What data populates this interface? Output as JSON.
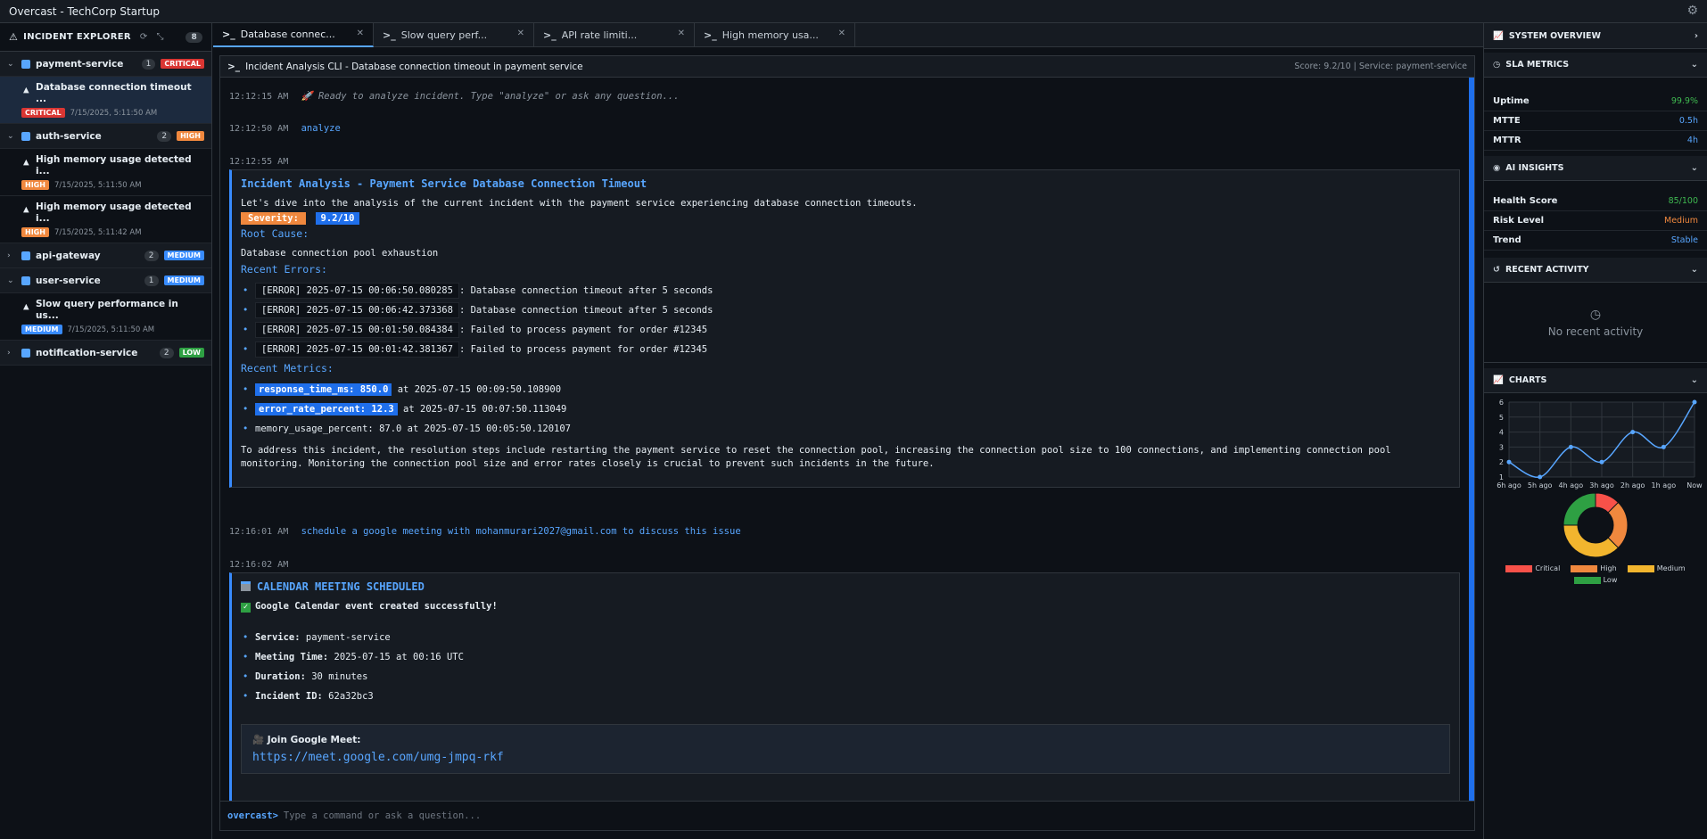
{
  "app": {
    "title": "Overcast - TechCorp Startup"
  },
  "sidebar": {
    "header": "INCIDENT EXPLORER",
    "count": "8",
    "services": [
      {
        "name": "payment-service",
        "count": "1",
        "severity": "CRITICAL",
        "incidents": [
          {
            "title": "Database connection timeout ...",
            "severity": "CRITICAL",
            "time": "7/15/2025, 5:11:50 AM"
          }
        ]
      },
      {
        "name": "auth-service",
        "count": "2",
        "severity": "HIGH",
        "incidents": [
          {
            "title": "High memory usage detected i...",
            "severity": "HIGH",
            "time": "7/15/2025, 5:11:50 AM"
          },
          {
            "title": "High memory usage detected i...",
            "severity": "HIGH",
            "time": "7/15/2025, 5:11:42 AM"
          }
        ]
      },
      {
        "name": "api-gateway",
        "count": "2",
        "severity": "MEDIUM",
        "incidents": []
      },
      {
        "name": "user-service",
        "count": "1",
        "severity": "MEDIUM",
        "incidents": [
          {
            "title": "Slow query performance in us...",
            "severity": "MEDIUM",
            "time": "7/15/2025, 5:11:50 AM"
          }
        ]
      },
      {
        "name": "notification-service",
        "count": "2",
        "severity": "LOW",
        "incidents": []
      }
    ]
  },
  "tabs": [
    {
      "label": "Database connec..."
    },
    {
      "label": "Slow query perf..."
    },
    {
      "label": "API rate limiti..."
    },
    {
      "label": "High memory usa..."
    }
  ],
  "main": {
    "header": "Incident Analysis CLI - Database connection timeout in payment service",
    "score": "Score: 9.2/10 | Service: payment-service",
    "log": {
      "l1_time": "12:12:15 AM",
      "l1_text": "🚀 Ready to analyze incident. Type \"analyze\" or ask any question...",
      "l2_time": "12:12:50 AM",
      "l2_text": "analyze",
      "l3_time": "12:12:55 AM",
      "analysis": {
        "title": "Incident Analysis - Payment Service Database Connection Timeout",
        "intro": "Let's dive into the analysis of the current incident with the payment service experiencing database connection timeouts.",
        "severity_label": "Severity:",
        "severity_value": "9.2/10",
        "root_cause_h": "Root Cause:",
        "root_cause": "Database connection pool exhaustion",
        "errors_h": "Recent Errors:",
        "errors": [
          {
            "code": "[ERROR] 2025-07-15 00:06:50.080285",
            "msg": ": Database connection timeout after 5 seconds"
          },
          {
            "code": "[ERROR] 2025-07-15 00:06:42.373368",
            "msg": ": Database connection timeout after 5 seconds"
          },
          {
            "code": "[ERROR] 2025-07-15 00:01:50.084384",
            "msg": ": Failed to process payment for order #12345"
          },
          {
            "code": "[ERROR] 2025-07-15 00:01:42.381367",
            "msg": ": Failed to process payment for order #12345"
          }
        ],
        "metrics_h": "Recent Metrics:",
        "metrics": [
          {
            "tag": "response_time_ms: 850.0",
            "rest": " at 2025-07-15 00:09:50.108900"
          },
          {
            "tag": "error_rate_percent: 12.3",
            "rest": " at 2025-07-15 00:07:50.113049"
          },
          {
            "tag": "",
            "rest": "memory_usage_percent: 87.0 at 2025-07-15 00:05:50.120107"
          }
        ],
        "resolution": "To address this incident, the resolution steps include restarting the payment service to reset the connection pool, increasing the connection pool size to 100 connections, and implementing connection pool monitoring. Monitoring the connection pool size and error rates closely is crucial to prevent such incidents in the future."
      },
      "l4_time": "12:16:01 AM",
      "l4_text": "schedule a google meeting with mohanmurari2027@gmail.com to discuss this issue",
      "l5_time": "12:16:02 AM",
      "meeting": {
        "title": "CALENDAR MEETING SCHEDULED",
        "success": "Google Calendar event created successfully!",
        "items": [
          {
            "k": "Service:",
            "v": " payment-service"
          },
          {
            "k": "Meeting Time:",
            "v": " 2025-07-15 at 00:16 UTC"
          },
          {
            "k": "Duration:",
            "v": " 30 minutes"
          },
          {
            "k": "Incident ID:",
            "v": " 62a32bc3"
          }
        ],
        "join_label": "🎥 Join Google Meet:",
        "url": "https://meet.google.com/umg-jmpq-rkf"
      }
    },
    "input": {
      "prompt": "overcast>",
      "placeholder": "Type a command or ask a question..."
    }
  },
  "right": {
    "overview": "SYSTEM OVERVIEW",
    "sla": {
      "header": "SLA METRICS",
      "rows": [
        {
          "k": "Uptime",
          "v": "99.9%"
        },
        {
          "k": "MTTE",
          "v": "0.5h"
        },
        {
          "k": "MTTR",
          "v": "4h"
        }
      ]
    },
    "ai": {
      "header": "AI INSIGHTS",
      "rows": [
        {
          "k": "Health Score",
          "v": "85/100"
        },
        {
          "k": "Risk Level",
          "v": "Medium"
        },
        {
          "k": "Trend",
          "v": "Stable"
        }
      ]
    },
    "activity": {
      "header": "RECENT ACTIVITY",
      "empty": "No recent activity"
    },
    "charts": {
      "header": "CHARTS"
    }
  },
  "chart_data": [
    {
      "type": "line",
      "categories": [
        "6h ago",
        "5h ago",
        "4h ago",
        "3h ago",
        "2h ago",
        "1h ago",
        "Now"
      ],
      "values": [
        2,
        1,
        3,
        2,
        4,
        3,
        6
      ],
      "ylim": [
        1,
        6
      ],
      "yticks": [
        "1",
        "2",
        "3",
        "4",
        "5",
        "6"
      ],
      "color": "#58a6ff",
      "grid": true
    },
    {
      "type": "pie",
      "donut": true,
      "labels": [
        "Critical",
        "High",
        "Medium",
        "Low"
      ],
      "values": [
        1,
        2,
        3,
        2
      ],
      "colors": [
        "#f85149",
        "#f0883e",
        "#f2b52e",
        "#2ea043"
      ],
      "legend": "bottom"
    }
  ]
}
